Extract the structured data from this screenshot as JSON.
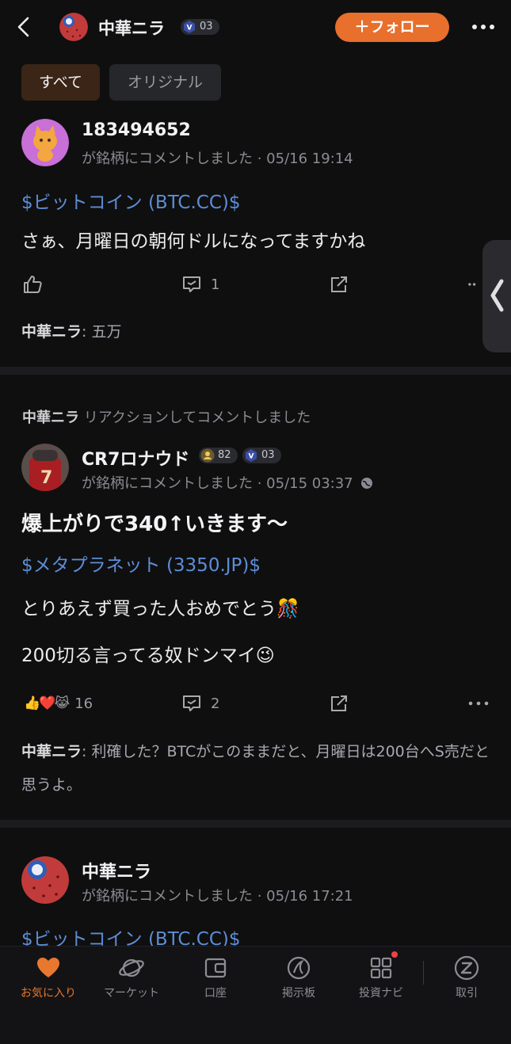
{
  "header": {
    "name": "中華ニラ",
    "level": "03",
    "follow_label": "＋フォロー"
  },
  "tabs": {
    "all": "すべて",
    "original": "オリジナル"
  },
  "posts": [
    {
      "user": "183494652",
      "meta": "が銘柄にコメントしました · 05/16 19:14",
      "ticker": "$ビットコイン (BTC.CC)$",
      "text": "さぁ、月曜日の朝何ドルになってますかね",
      "comment_count": "1",
      "reply_author": "中華ニラ",
      "reply_text": ": 五万"
    },
    {
      "context_author": "中華ニラ",
      "context_text": " リアクションしてコメントしました",
      "user": "CR7ロナウド",
      "badge1": "82",
      "badge2": "03",
      "meta": "が銘柄にコメントしました · 05/15 03:37",
      "headline": "爆上がりで340↑いきます〜",
      "ticker": "$メタプラネット (3350.JP)$",
      "line1": "とりあえず買った人おめでとう🎊",
      "line2": "200切る言ってる奴ドンマイ😉",
      "reaction_count": "16",
      "comment_count": "2",
      "reply_author": "中華ニラ",
      "reply_text": ": 利確した？BTCがこのままだと、月曜日は200台へS売だと思うよ。"
    },
    {
      "user": "中華ニラ",
      "meta": "が銘柄にコメントしました · 05/16 17:21",
      "ticker": "$ビットコイン (BTC.CC)$"
    }
  ],
  "nav": {
    "favorites": "お気に入り",
    "market": "マーケット",
    "account": "口座",
    "board": "掲示板",
    "navi": "投資ナビ",
    "trade": "取引"
  },
  "colors": {
    "accent": "#e86f2c",
    "link": "#5d8dd6",
    "background": "#0f0f10"
  }
}
